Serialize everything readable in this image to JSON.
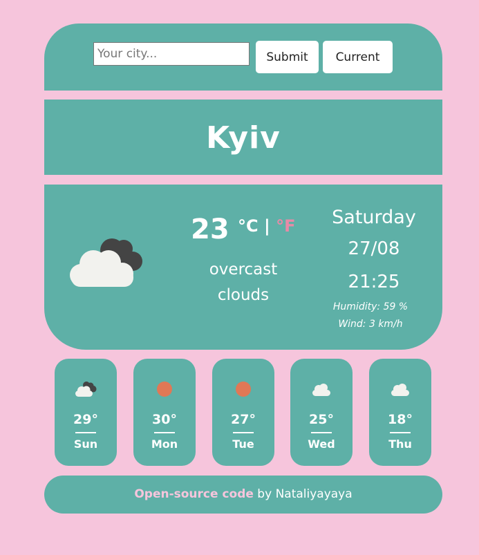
{
  "search": {
    "placeholder": "Your city...",
    "value": ""
  },
  "buttons": {
    "submit": "Submit",
    "current": "Current"
  },
  "current": {
    "city": "Kyiv",
    "temperature": "23",
    "unit_c": "°C",
    "separator": " | ",
    "unit_f": "°F",
    "description_line1": "overcast",
    "description_line2": "clouds",
    "icon": "overcast-clouds-icon",
    "day": "Saturday",
    "date": "27/08",
    "time": "21:25",
    "humidity": "Humidity: 59 %",
    "wind": "Wind: 3 km/h"
  },
  "forecast": [
    {
      "temp": "29°",
      "day": "Sun",
      "icon": "broken-clouds-icon"
    },
    {
      "temp": "30°",
      "day": "Mon",
      "icon": "sun-icon"
    },
    {
      "temp": "27°",
      "day": "Tue",
      "icon": "sun-icon"
    },
    {
      "temp": "25°",
      "day": "Wed",
      "icon": "cloud-icon"
    },
    {
      "temp": "18°",
      "day": "Thu",
      "icon": "cloud-icon"
    }
  ],
  "footer": {
    "link_text": "Open-source code",
    "suffix": " by Nataliyayaya"
  },
  "colors": {
    "background": "#f6c5dc",
    "panel": "#5eb0a7",
    "accent": "#e88aa7",
    "sun": "#e07856",
    "cloud": "#f2f2ee",
    "dark_cloud": "#444444"
  }
}
